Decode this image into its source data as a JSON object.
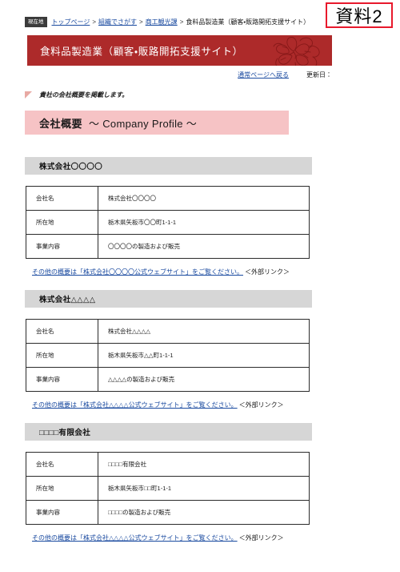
{
  "stamp": {
    "label": "資料2",
    "border_color": "#e8192c"
  },
  "breadcrumb": {
    "badge": "現在地",
    "items": [
      {
        "label": "トップページ",
        "link": true
      },
      {
        "label": "組織でさがす",
        "link": true
      },
      {
        "label": "商工観光課",
        "link": true
      },
      {
        "label": "食料品製造業（顧客・販路開拓支援サイト）",
        "link": false
      }
    ],
    "separator": ">"
  },
  "banner": {
    "title": "食料品製造業（顧客・販路開拓支援サイト）",
    "background_color": "#ad2a2a",
    "text_color": "#ffffff",
    "decoration": "flower-line-art"
  },
  "utility": {
    "back_link": "通常ページへ戻る",
    "updated_label": "更新日："
  },
  "lead": {
    "note": "貴社の会社概要を掲載します。",
    "marker_color": "#e8a9a3"
  },
  "section": {
    "title_jp": "会社概要",
    "title_en": "～ Company Profile ～",
    "background_color": "#f6c3c5"
  },
  "table_labels": {
    "company_name": "会社名",
    "address": "所在地",
    "business": "事業内容"
  },
  "companies": [
    {
      "heading": "株式会社〇〇〇〇",
      "rows": [
        {
          "label": "会社名",
          "value": "株式会社〇〇〇〇"
        },
        {
          "label": "所在地",
          "value": "栃木県矢板市〇〇町1-1-1"
        },
        {
          "label": "事業内容",
          "value": "〇〇〇〇の製造および販売"
        }
      ],
      "external_link_text": "その他の概要は「株式会社〇〇〇〇公式ウェブサイト」をご覧ください。",
      "external_link_tag": "＜外部リンク＞"
    },
    {
      "heading": "株式会社△△△△",
      "rows": [
        {
          "label": "会社名",
          "value": "株式会社△△△△"
        },
        {
          "label": "所在地",
          "value": "栃木県矢板市△△町1-1-1"
        },
        {
          "label": "事業内容",
          "value": "△△△△の製造および販売"
        }
      ],
      "external_link_text": "その他の概要は「株式会社△△△△公式ウェブサイト」をご覧ください。",
      "external_link_tag": "＜外部リンク＞"
    },
    {
      "heading": "□□□□有限会社",
      "rows": [
        {
          "label": "会社名",
          "value": "□□□□有限会社"
        },
        {
          "label": "所在地",
          "value": "栃木県矢板市□□町1-1-1"
        },
        {
          "label": "事業内容",
          "value": "□□□□の製造および販売"
        }
      ],
      "external_link_text": "その他の概要は「株式会社△△△△公式ウェブサイト」をご覧ください。",
      "external_link_tag": "＜外部リンク＞"
    }
  ]
}
